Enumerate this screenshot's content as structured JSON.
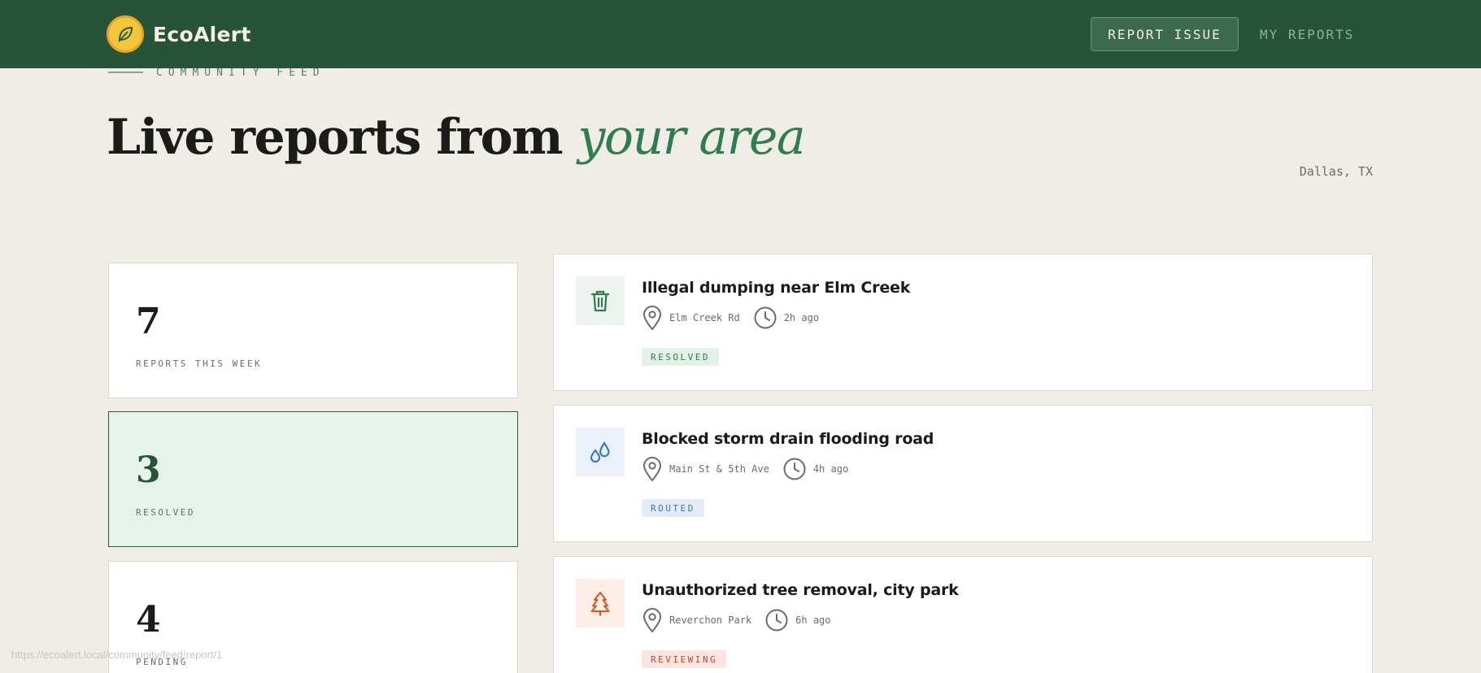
{
  "header": {
    "brand": "EcoAlert",
    "report_button": "REPORT ISSUE",
    "my_reports_link": "MY REPORTS",
    "brand_color": "#26533a"
  },
  "hero": {
    "eyebrow": "COMMUNITY FEED",
    "title_plain": "Live reports from ",
    "title_accent": "your area",
    "location": "Dallas, TX"
  },
  "stats": [
    {
      "value": "7",
      "label": "REPORTS THIS WEEK"
    },
    {
      "value": "3",
      "label": "RESOLVED"
    },
    {
      "value": "4",
      "label": "PENDING"
    }
  ],
  "reports": [
    {
      "title": "Illegal dumping near Elm Creek",
      "location": "Elm Creek Rd",
      "time": "2h ago",
      "status": "RESOLVED",
      "icon": "trash-icon"
    },
    {
      "title": "Blocked storm drain flooding road",
      "location": "Main St & 5th Ave",
      "time": "4h ago",
      "status": "ROUTED",
      "icon": "water-drops-icon"
    },
    {
      "title": "Unauthorized tree removal, city park",
      "location": "Reverchon Park",
      "time": "6h ago",
      "status": "REVIEWING",
      "icon": "tree-icon"
    }
  ],
  "status_colors": {
    "resolved": {
      "bg": "#e3f2e7",
      "fg": "#2f7c4e"
    },
    "routed": {
      "bg": "#e3ecfb",
      "fg": "#3f6fc4"
    },
    "reviewing": {
      "bg": "#fbe5e0",
      "fg": "#c2462c"
    }
  },
  "status_bar": {
    "url": "https://ecoalert.local/community/feed/report/1"
  }
}
